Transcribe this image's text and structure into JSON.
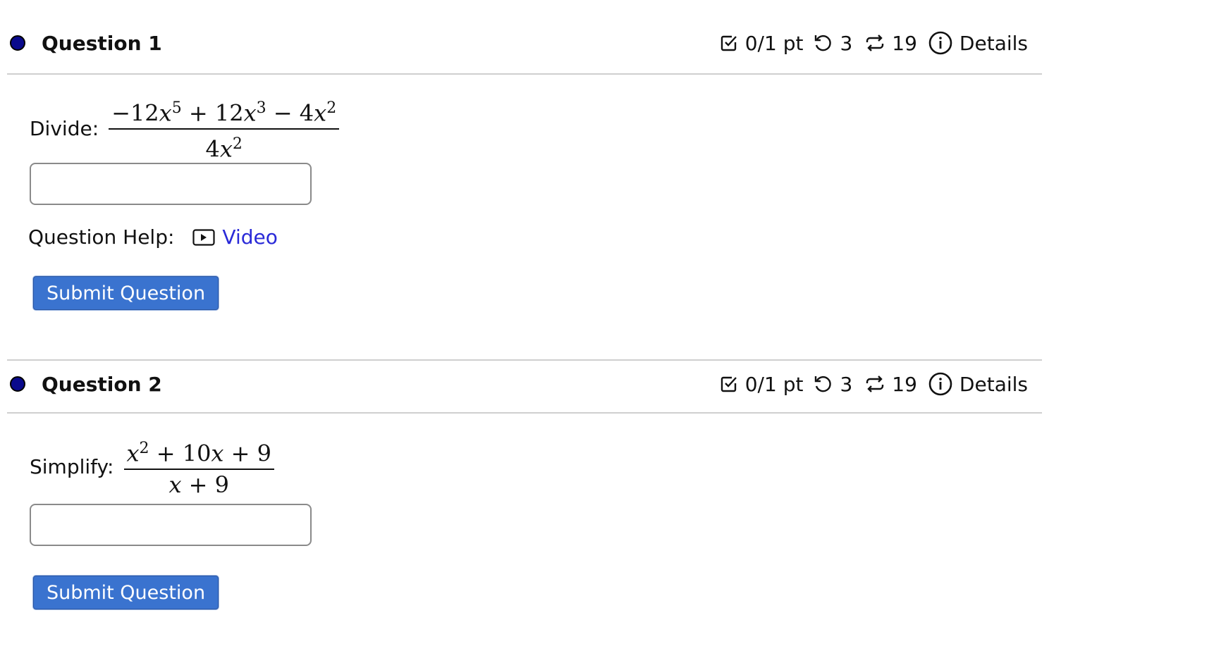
{
  "questions": [
    {
      "title": "Question 1",
      "score": "0/1 pt",
      "retries": "3",
      "attempts": "19",
      "details_label": "Details",
      "prompt_label": "Divide:",
      "fraction": {
        "numerator": {
          "c1": "−12",
          "v1": "x",
          "e1": "5",
          "op1": "+",
          "c2": "12",
          "v2": "x",
          "e2": "3",
          "op2": "−",
          "c3": "4",
          "v3": "x",
          "e3": "2"
        },
        "denominator": {
          "c1": "4",
          "v1": "x",
          "e1": "2"
        }
      },
      "answer_value": "",
      "help_label": "Question Help:",
      "help_video_label": "Video",
      "submit_label": "Submit Question"
    },
    {
      "title": "Question 2",
      "score": "0/1 pt",
      "retries": "3",
      "attempts": "19",
      "details_label": "Details",
      "prompt_label": "Simplify:",
      "fraction": {
        "numerator": {
          "v1": "x",
          "e1": "2",
          "op1": "+",
          "c2": "10",
          "v2": "x",
          "op2": "+",
          "c3": "9"
        },
        "denominator": {
          "v1": "x",
          "op1": "+",
          "c2": "9"
        }
      },
      "answer_value": "",
      "submit_label": "Submit Question"
    }
  ],
  "icons": {
    "status_dot": "filled-circle-icon",
    "score": "checkbox-icon",
    "retries": "undo-icon",
    "attempts": "repeat-icon",
    "details": "info-icon",
    "video": "video-icon"
  },
  "colors": {
    "status_dot": "#0a0a8c",
    "submit_bg": "#3a73cf",
    "link": "#2a2ad8",
    "rule": "#cfcfcf"
  }
}
